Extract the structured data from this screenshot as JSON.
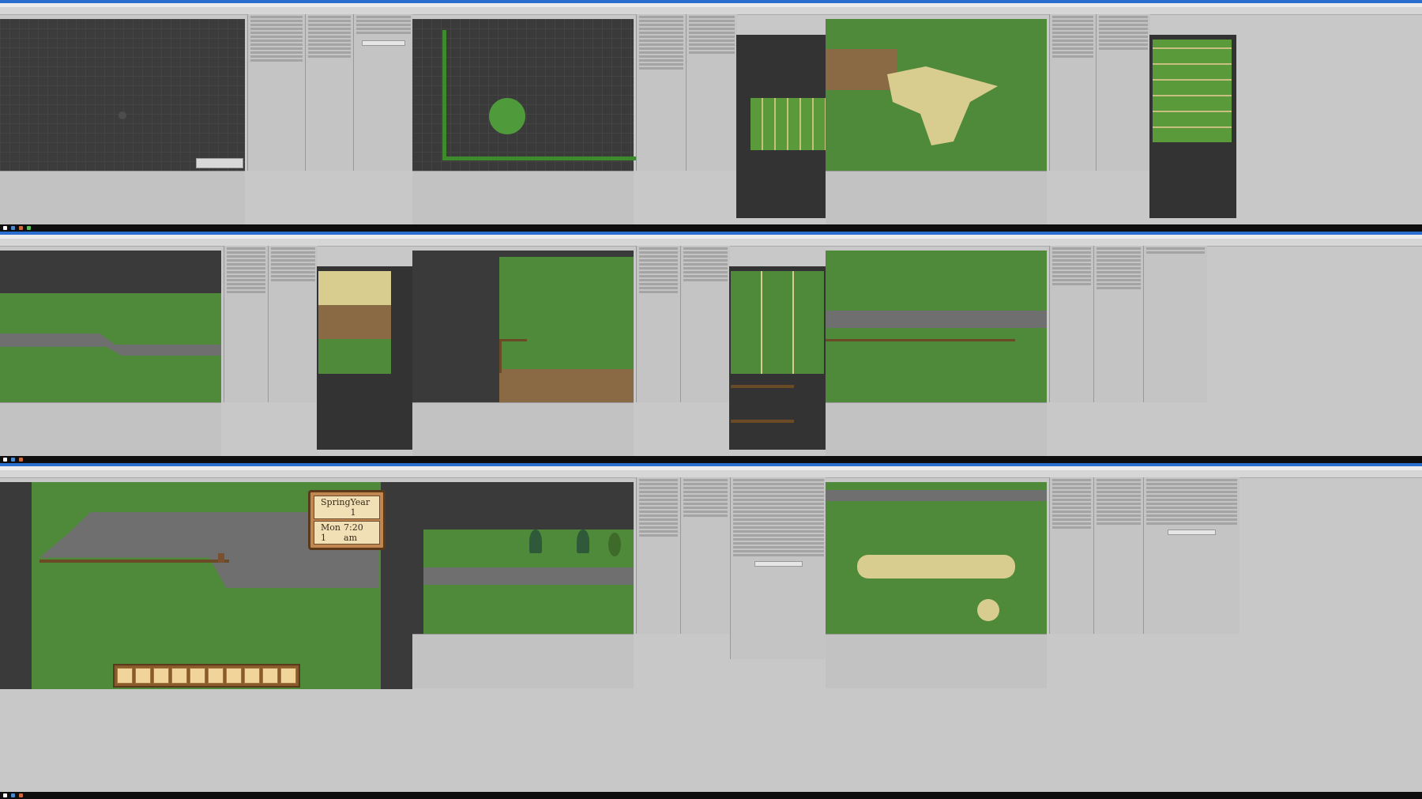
{
  "screens": [
    {
      "id": "s1"
    },
    {
      "id": "s2"
    },
    {
      "id": "s3"
    },
    {
      "id": "s4"
    },
    {
      "id": "s5"
    },
    {
      "id": "s6"
    },
    {
      "id": "s7"
    },
    {
      "id": "s8"
    },
    {
      "id": "s9"
    }
  ],
  "game_hud": {
    "season": "Spring",
    "year": "Year 1",
    "day": "Mon 1",
    "time": "7:20 am"
  },
  "colors": {
    "grass": "#4f8a3a",
    "grass_dark": "#3d7030",
    "path": "#d9cc8f",
    "dirt": "#8a6a45",
    "stone": "#6f6f6f",
    "fence": "#6b4a26",
    "unity_bg": "#3a3a3a",
    "panel_bg": "#c4c4c4",
    "titlebar": "#2a6ed0"
  }
}
